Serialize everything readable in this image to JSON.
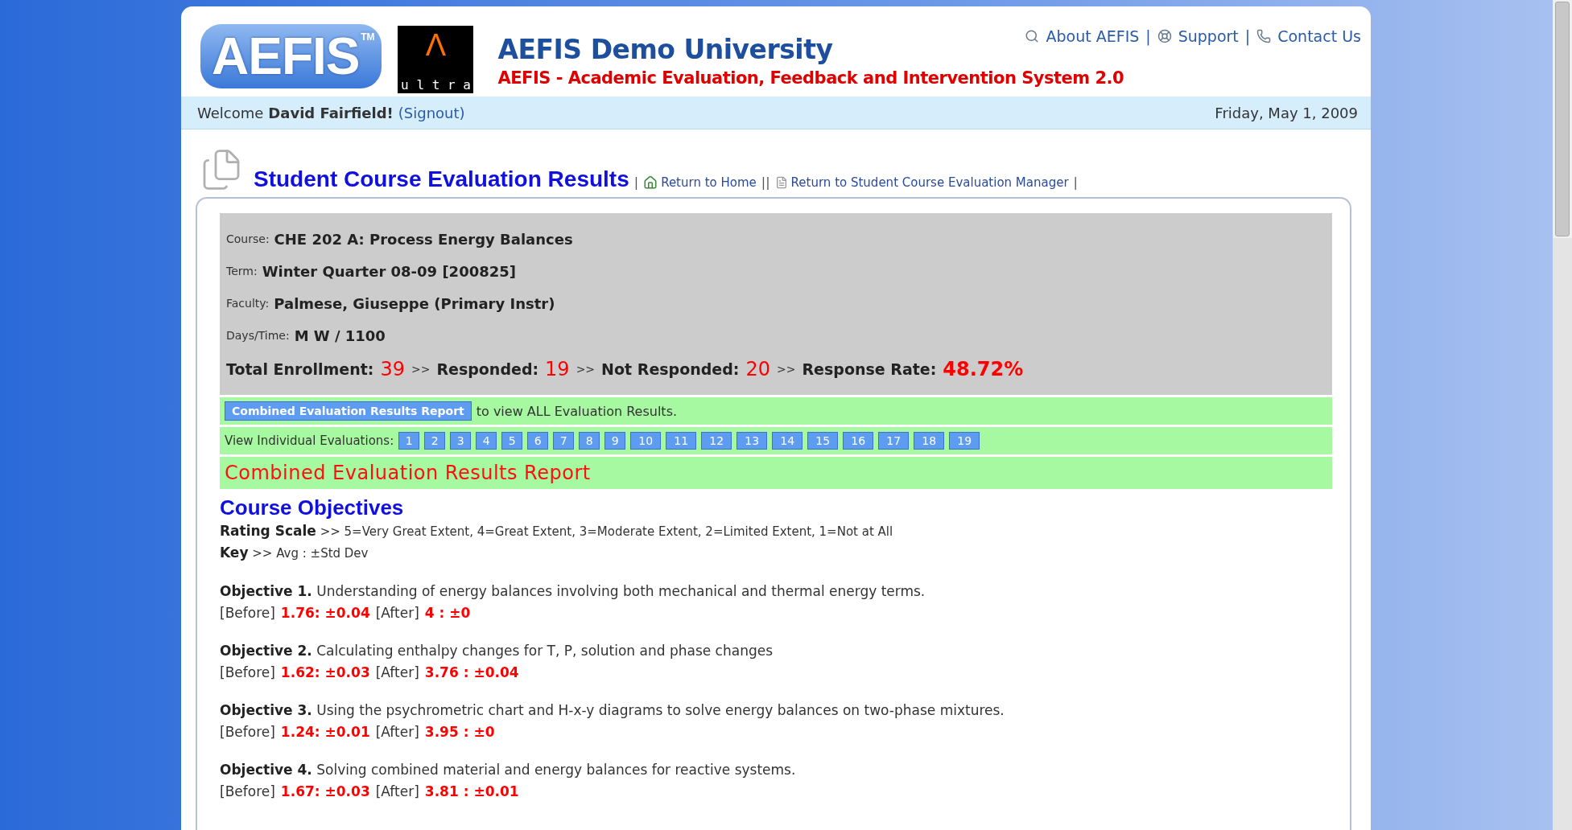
{
  "header": {
    "logo": "AEFIS",
    "logo_mark": "TM",
    "partner_logo_glyph": "Λ",
    "partner_logo_text": "u l t r a",
    "title": "AEFIS Demo University",
    "subtitle": "AEFIS - Academic Evaluation, Feedback and Intervention System 2.0",
    "links": [
      {
        "kind": "about",
        "label": "About AEFIS"
      },
      {
        "kind": "support",
        "label": "Support"
      },
      {
        "kind": "contact",
        "label": "Contact Us"
      }
    ],
    "separator": "|"
  },
  "welcome_bar": {
    "greeting": "Welcome",
    "user": "David Fairfield",
    "exclaim": "!",
    "signout": "(Signout)",
    "date": "Friday, May 1, 2009"
  },
  "page_title": "Student Course Evaluation Results",
  "nav_separators": {
    "open": "|",
    "middle": "||",
    "close": "|"
  },
  "nav_links": [
    {
      "kind": "home",
      "label": "Return to Home"
    },
    {
      "kind": "manager",
      "label": "Return to Student Course Evaluation Manager"
    }
  ],
  "course_info": [
    {
      "label": "Course:",
      "value": "CHE 202 A: Process Energy Balances"
    },
    {
      "label": "Term:",
      "value": "Winter Quarter 08-09 [200825]"
    },
    {
      "label": "Faculty:",
      "value": "Palmese, Giuseppe (Primary Instr)"
    },
    {
      "label": "Days/Time:",
      "value": "M W / 1100"
    }
  ],
  "stats": [
    {
      "label": "Total Enrollment:",
      "value": "39"
    },
    {
      "label": "Responded:",
      "value": "19"
    },
    {
      "label": "Not Responded:",
      "value": "20"
    },
    {
      "label": "Response Rate:",
      "value": "48.72%"
    }
  ],
  "stats_separator": ">>",
  "combined_button": "Combined Evaluation Results Report",
  "combined_hint": "to view ALL Evaluation Results.",
  "individual_label": "View Individual Evaluations:",
  "individual_evaluations": [
    "1",
    "2",
    "3",
    "4",
    "5",
    "6",
    "7",
    "8",
    "9",
    "10",
    "11",
    "12",
    "13",
    "14",
    "15",
    "16",
    "17",
    "18",
    "19"
  ],
  "report_title": "Combined Evaluation Results Report",
  "section_title": "Course Objectives",
  "rating_scale": {
    "label": "Rating Scale",
    "text": ">> 5=Very Great Extent, 4=Great Extent, 3=Moderate Extent, 2=Limited Extent, 1=Not at All"
  },
  "key": {
    "label": "Key",
    "text": ">> Avg : ±Std Dev"
  },
  "objectives": [
    {
      "label": "Objective 1.",
      "text": "Understanding of energy balances involving both mechanical and thermal energy terms.",
      "before_label": "[Before]",
      "before": "1.76: ±0.04",
      "after_label": "[After]",
      "after": "4 : ±0"
    },
    {
      "label": "Objective 2.",
      "text": "Calculating enthalpy changes for T, P, solution and phase changes",
      "before_label": "[Before]",
      "before": "1.62: ±0.03",
      "after_label": "[After]",
      "after": "3.76 : ±0.04"
    },
    {
      "label": "Objective 3.",
      "text": "Using the psychrometric chart and H-x-y diagrams to solve energy balances on two-phase mixtures.",
      "before_label": "[Before]",
      "before": "1.24: ±0.01",
      "after_label": "[After]",
      "after": "3.95 : ±0"
    },
    {
      "label": "Objective 4.",
      "text": "Solving combined material and energy balances for reactive systems.",
      "before_label": "[Before]",
      "before": "1.67: ±0.03",
      "after_label": "[After]",
      "after": "3.81 : ±0.01"
    }
  ]
}
